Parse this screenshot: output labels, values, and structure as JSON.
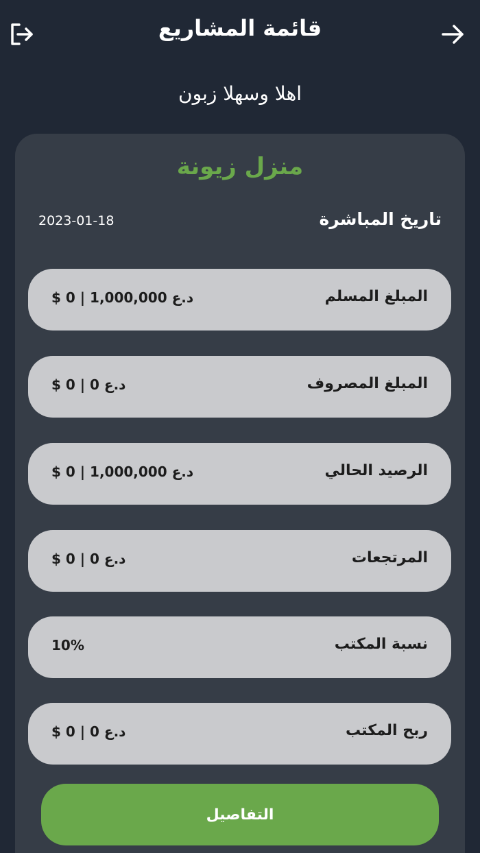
{
  "header": {
    "title": "قائمة المشاريع",
    "back_icon": "arrow-right-icon",
    "logout_icon": "logout-icon"
  },
  "greeting": "اهلا وسهلا زبون",
  "project": {
    "name": "منزل زيونة",
    "start_date_label": "تاريخ المباشرة",
    "start_date": "2023-01-18",
    "rows": [
      {
        "label": "المبلغ المسلم",
        "value": "$ 0 | 1,000,000 د.ع"
      },
      {
        "label": "المبلغ المصروف",
        "value": "$ 0 | 0 د.ع"
      },
      {
        "label": "الرصيد الحالي",
        "value": "$ 0 | 1,000,000 د.ع"
      },
      {
        "label": "المرتجعات",
        "value": "$ 0 | 0 د.ع"
      },
      {
        "label": "نسبة المكتب",
        "value": "10%"
      },
      {
        "label": "ربح المكتب",
        "value": "$ 0 | 0 د.ع"
      }
    ],
    "details_button": "التفاصيل"
  },
  "colors": {
    "background": "#202835",
    "card": "#363d47",
    "pill": "#c9cacd",
    "accent_green": "#6aa84b"
  }
}
